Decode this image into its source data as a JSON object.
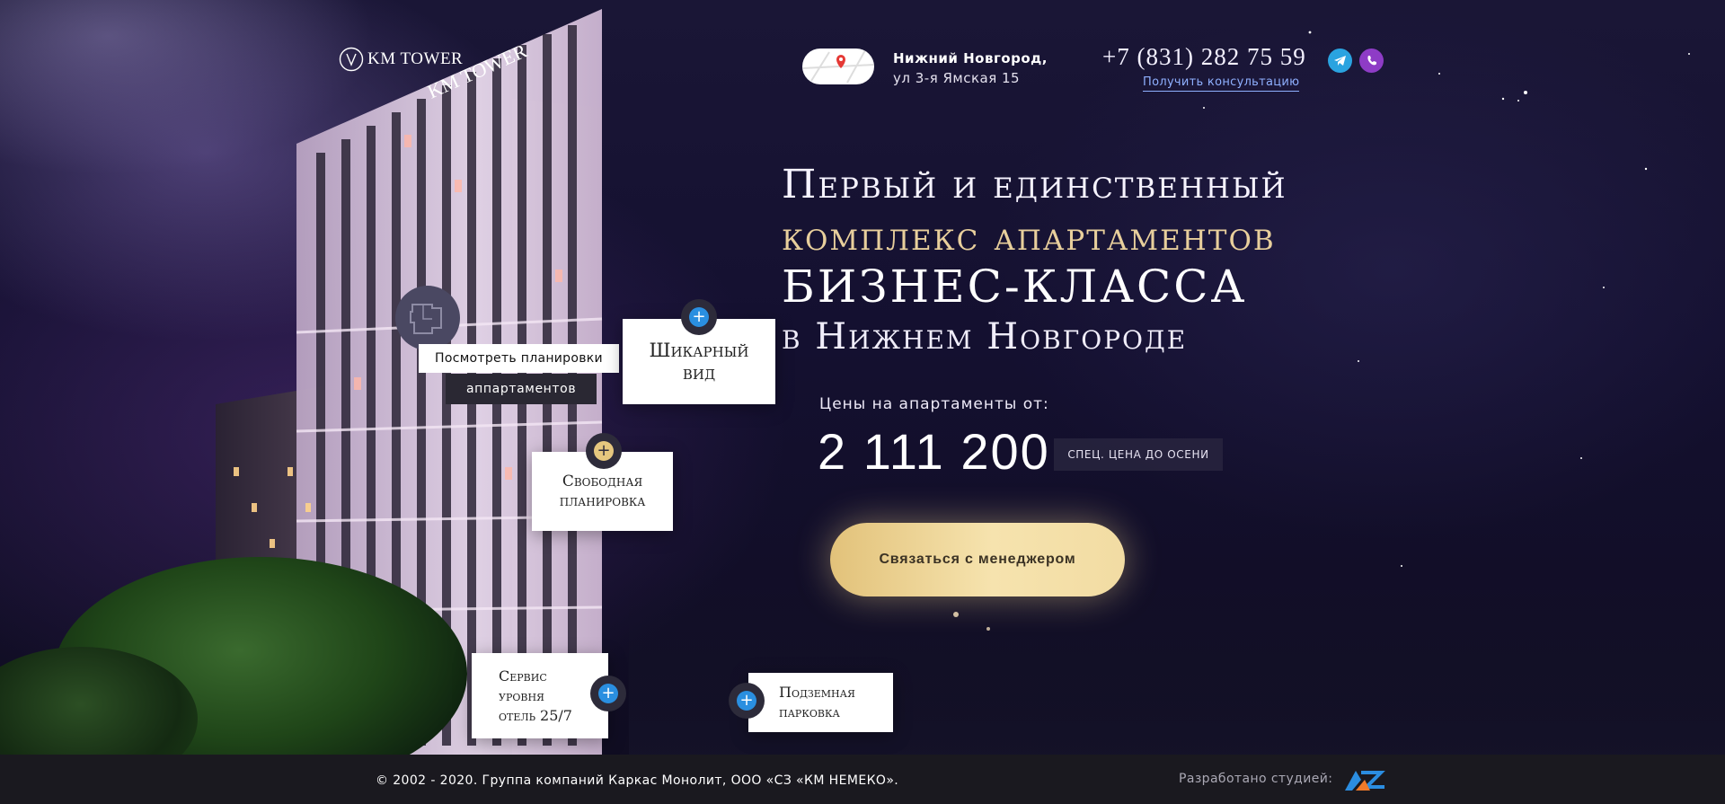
{
  "header": {
    "logo_text": "KM TOWER",
    "address_city": "Нижний Новгород,",
    "address_street": "ул 3-я Ямская 15",
    "phone": "+7 (831) 282 75 59",
    "consult_link": "Получить консультацию",
    "social": [
      "telegram-icon",
      "viber-icon"
    ]
  },
  "hero": {
    "line1": "Первый и единственный",
    "line2": "комплекс апартаментов",
    "line3": "БИЗНЕС-КЛАССА",
    "line4": "в Нижнем Новгороде",
    "price_label": "Цены на апартаменты от:",
    "price": "2 111 200",
    "price_badge": "СПЕЦ. ЦЕНА ДО ОСЕНИ",
    "cta": "Связаться с менеджером"
  },
  "building": {
    "sign": "KM TOWER",
    "plans_label_a": "Посмотреть",
    "plans_label_b": "планировки",
    "plans_label_c": "аппартаментов",
    "cards": [
      {
        "l1": "Шикарный",
        "l2": "вид"
      },
      {
        "l1": "Свободная",
        "l2": "планировка"
      },
      {
        "l1": "Сервис",
        "l2": "уровня",
        "l3": "отель 25/7"
      },
      {
        "l1": "Подземная",
        "l2": "парковка"
      }
    ]
  },
  "footer": {
    "copyright": "© 2002 - 2020. Группа компаний Каркас Монолит, ООО «СЗ «КМ НЕМЕКО».",
    "developer_label": "Разработано студией:"
  },
  "colors": {
    "accent_gold": "#e8cf9c",
    "link_blue": "#8fb0ff",
    "telegram": "#2aa3e0",
    "viber": "#8e3cc6"
  }
}
